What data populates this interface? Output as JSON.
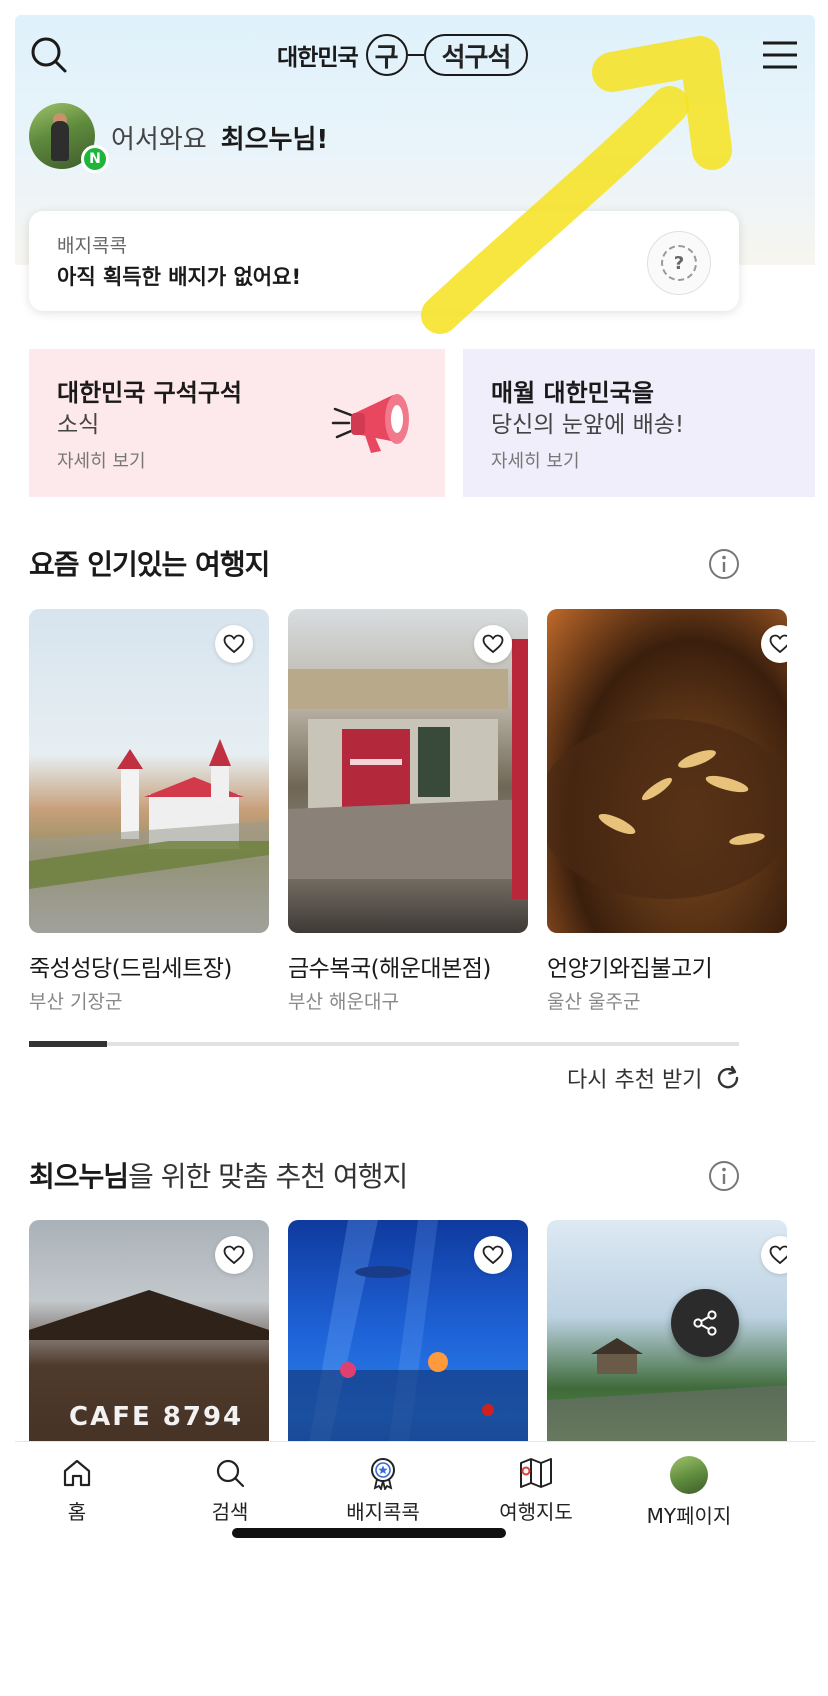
{
  "header": {
    "logo_word": "대한민국",
    "logo_circle": "구",
    "logo_pill": "석구석"
  },
  "greeting": {
    "prefix": "어서와요",
    "name": "최으누님!",
    "badge_letter": "N"
  },
  "badge_card": {
    "label": "배지콕콕",
    "message": "아직 획득한 배지가 없어요!",
    "help_symbol": "?"
  },
  "banners": [
    {
      "title": "대한민국 구석구석",
      "subtitle": "소식",
      "more": "자세히 보기",
      "bg": "#fde9ec"
    },
    {
      "title": "매월 대한민국을",
      "subtitle": "당신의 눈앞에 배송!",
      "more": "자세히 보기",
      "bg": "#f1eefb"
    }
  ],
  "popular": {
    "title": "요즘 인기있는 여행지",
    "items": [
      {
        "name": "죽성성당(드림세트장)",
        "location": "부산 기장군",
        "image": "church-by-sea"
      },
      {
        "name": "금수복국(해운대본점)",
        "location": "부산 해운대구",
        "image": "restaurant-building"
      },
      {
        "name": "언양기와집불고기",
        "location": "울산 울주군",
        "image": "bulgogi-food"
      }
    ],
    "scroll_progress": 0.11,
    "refresh_label": "다시 추천 받기"
  },
  "recommend": {
    "title_name": "최으누님",
    "title_rest": "을 위한 맞춤 추천 여행지",
    "items": [
      {
        "image": "cafe-8794",
        "sign": "CAFE 8794"
      },
      {
        "image": "aquarium"
      },
      {
        "image": "forest-park"
      }
    ]
  },
  "nav": [
    {
      "label": "홈",
      "icon": "home-icon"
    },
    {
      "label": "검색",
      "icon": "search-icon"
    },
    {
      "label": "배지콕콕",
      "icon": "badge-icon"
    },
    {
      "label": "여행지도",
      "icon": "map-icon"
    },
    {
      "label": "MY페이지",
      "icon": "avatar"
    }
  ],
  "colors": {
    "accent_yellow": "#f6e21d",
    "badge_green": "#1fb53c",
    "megaphone_red": "#e8475f"
  }
}
